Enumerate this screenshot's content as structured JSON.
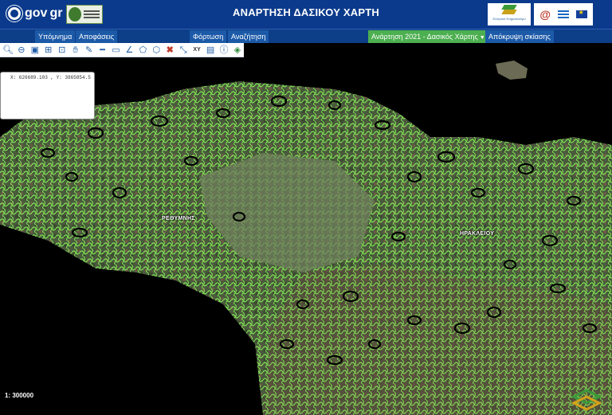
{
  "header": {
    "govgr_text": "gov",
    "govgr_suffix": "gr",
    "title": "ΑΝΑΡΤΗΣΗ ΔΑΣΙΚΟΥ ΧΑΡΤΗ",
    "ktima_caption": "Ελληνικό Κτηματολόγιο"
  },
  "menu": {
    "ypomnima": "Υπόμνημα",
    "apofaseis": "Αποφάσεις",
    "fortosi": "Φόρτωση",
    "anazitisi": "Αναζήτηση",
    "layer_select": "Ανάρτηση 2021 - Δασικός Χάρτης",
    "hide_shading": "Απόκρυψη σκίασης"
  },
  "toolbar": {
    "icons": [
      "zoom-in-icon",
      "zoom-out-icon",
      "full-extent-icon",
      "zoom-box-icon",
      "zoom-previous-icon",
      "pan-icon",
      "identify-icon",
      "measure-line-icon",
      "measure-polygon-icon",
      "measure-angle-icon",
      "draw-shape-icon",
      "polygon-select-icon",
      "clear-icon",
      "select-icon",
      "goto-xy-icon",
      "print-icon",
      "info-icon",
      "layers-icon"
    ],
    "xy_label": "XY"
  },
  "coordinates": {
    "text": "X: 626689.103 , Y: 3865854.5"
  },
  "map": {
    "labels": {
      "rethymnis": "ΡΕΘΥΜΝΗΣ",
      "irakleiou": "ΗΡΑΚΛΕΙΟΥ"
    },
    "scale": "1: 300000",
    "colors": {
      "forest_outline": "#8bff5a",
      "decision_outline": "#000000",
      "sea": "#000000"
    }
  }
}
